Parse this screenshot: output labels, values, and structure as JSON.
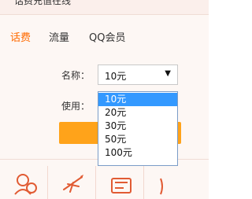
{
  "header": {
    "partial_title": "话费充值在线"
  },
  "tabs": [
    {
      "label": "话费",
      "active": true
    },
    {
      "label": "流量",
      "active": false
    },
    {
      "label": "QQ会员",
      "active": false
    }
  ],
  "form": {
    "name_label": "名称：",
    "use_label": "使用：",
    "selected_value": "10元"
  },
  "dropdown_options": [
    {
      "label": "10元",
      "selected": true
    },
    {
      "label": "20元",
      "selected": false
    },
    {
      "label": "30元",
      "selected": false
    },
    {
      "label": "50元",
      "selected": false
    },
    {
      "label": "100元",
      "selected": false
    }
  ],
  "colors": {
    "accent": "#ff6a00",
    "button": "#ffa31a",
    "selection": "#3399ff",
    "background": "#fdf7f4"
  },
  "icons": [
    "user-money-icon",
    "flight-icon",
    "ticket-icon",
    "partial-icon"
  ]
}
